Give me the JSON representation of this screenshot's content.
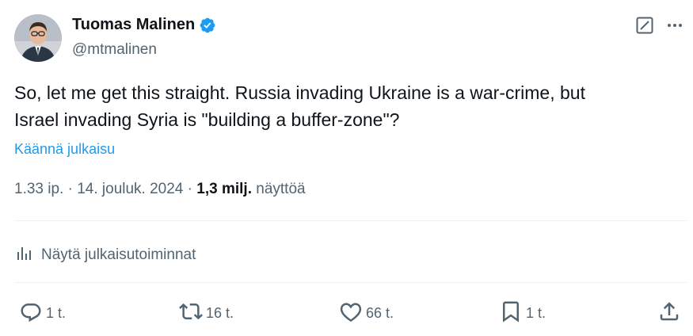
{
  "tweet": {
    "author": {
      "name": "Tuomas Malinen",
      "handle": "@mtmalinen",
      "verified_color": "#1d9bf0"
    },
    "text": "So, let me get this straight. Russia invading Ukraine is a war-crime, but\nIsrael invading Syria is \"building a buffer-zone\"?",
    "translate_label": "Käännä julkaisu",
    "time": "1.33 ip.",
    "date": "14. jouluk. 2024",
    "views_count": "1,3 milj.",
    "views_label": "näyttöä",
    "separator": " · "
  },
  "analytics": {
    "label": "Näytä julkaisutoiminnat",
    "icon": "bar-chart-icon"
  },
  "actions": {
    "reply": {
      "icon": "reply-icon",
      "count": "1 t."
    },
    "retweet": {
      "icon": "retweet-icon",
      "count": "16 t."
    },
    "like": {
      "icon": "heart-icon",
      "count": "66 t."
    },
    "bookmark": {
      "icon": "bookmark-icon",
      "count": "1 t."
    },
    "share": {
      "icon": "share-icon"
    }
  },
  "header_icons": {
    "grok": "grok-icon",
    "more": "more-icon"
  },
  "colors": {
    "text": "#0f1419",
    "secondary": "#536471",
    "accent": "#1d9bf0",
    "divider": "#eff3f4"
  }
}
